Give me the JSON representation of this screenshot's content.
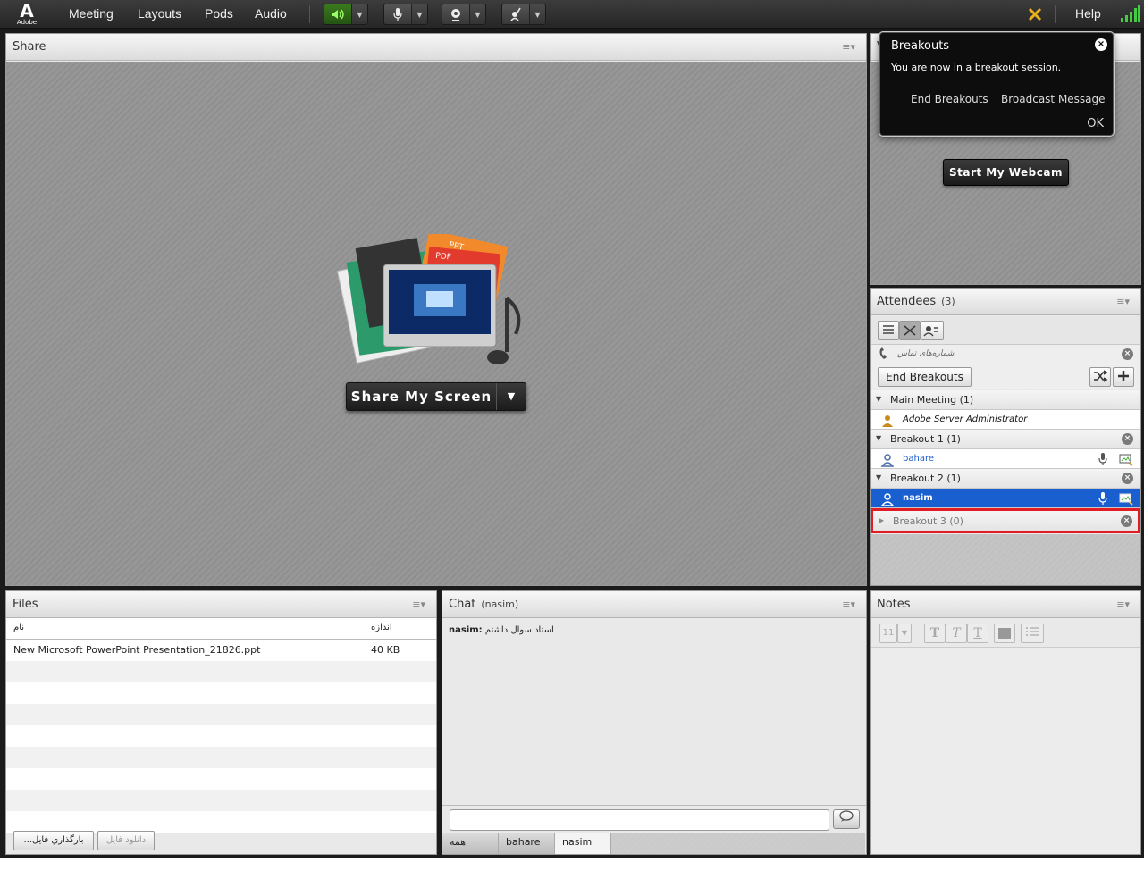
{
  "menubar": {
    "logo_letter": "A",
    "logo_word": "Adobe",
    "items": [
      "Meeting",
      "Layouts",
      "Pods",
      "Audio"
    ],
    "help": "Help",
    "icons": [
      "speaker-icon",
      "microphone-icon",
      "webcam-icon",
      "raise-hand-icon"
    ],
    "colors": {
      "speaker_active": "#3a7a1e",
      "status": "#e8b020"
    }
  },
  "share_pod": {
    "title": "Share",
    "button_label": "Share My Screen",
    "doc_labels": [
      "PPT",
      "PDF"
    ]
  },
  "video_pod": {
    "title_fragment": "V",
    "webcam_button": "Start My Webcam"
  },
  "breakouts_popup": {
    "title": "Breakouts",
    "message": "You are now in a breakout session.",
    "end_label": "End Breakouts",
    "broadcast_label": "Broadcast Message",
    "ok_label": "OK"
  },
  "attendees": {
    "title": "Attendees",
    "count": "(3)",
    "phone_label": "شماره‌های تماس",
    "end_breakouts": "End Breakouts",
    "main_meeting": "Main Meeting (1)",
    "host": "Adobe Server Administrator",
    "breakout1": "Breakout 1 (1)",
    "breakout1_user": "bahare",
    "breakout2": "Breakout 2 (1)",
    "breakout2_user": "nasim",
    "breakout3": "Breakout 3 (0)",
    "colors": {
      "selected": "#1a5fcf",
      "highlight": "#e01c24"
    }
  },
  "files": {
    "title": "Files",
    "col_name": "نام",
    "col_size": "اندازه",
    "rows": [
      {
        "name": "New Microsoft PowerPoint Presentation_21826.ppt",
        "size": "40 KB"
      }
    ],
    "upload_btn": "...بارگذاري فايل",
    "download_btn": "دانلود فايل"
  },
  "chat": {
    "title": "Chat",
    "context": "(nasim)",
    "messages": [
      {
        "sender": "nasim:",
        "text": "استاد سوال داشتم"
      }
    ],
    "tabs": [
      "همه",
      "bahare",
      "nasim"
    ]
  },
  "notes": {
    "title": "Notes",
    "font_size": "11"
  }
}
